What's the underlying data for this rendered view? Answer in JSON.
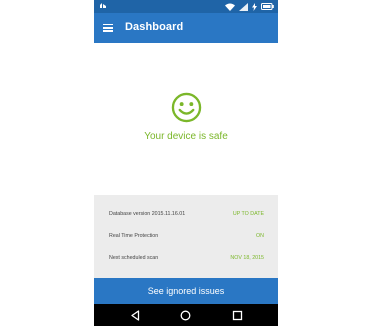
{
  "app_bar": {
    "title": "Dashboard"
  },
  "status": {
    "headline": "Your device is safe",
    "icon": "smiley-icon",
    "accent_color": "#7bb72a"
  },
  "info": {
    "rows": [
      {
        "label": "Database version 2015.11.16.01",
        "value": "UP TO DATE"
      },
      {
        "label": "Real Time Protection",
        "value": "ON"
      },
      {
        "label": "Next scheduled scan",
        "value": "NOV 18, 2015"
      }
    ]
  },
  "actions": {
    "ignored_label": "See ignored issues"
  },
  "colors": {
    "primary": "#2a77c4",
    "status_bar": "#1f64a7",
    "panel": "#ececec"
  }
}
